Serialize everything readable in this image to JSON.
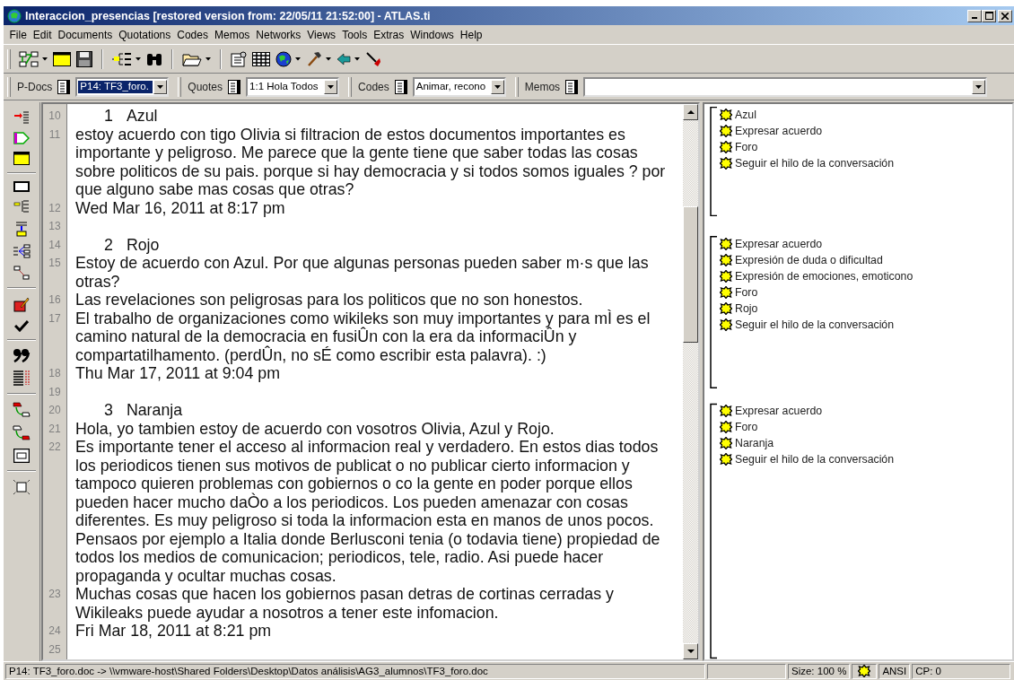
{
  "window": {
    "title": "Interaccion_presencias [restored version from: 22/05/11 21:52:00] - ATLAS.ti"
  },
  "menu": [
    "File",
    "Edit",
    "Documents",
    "Quotations",
    "Codes",
    "Memos",
    "Networks",
    "Views",
    "Tools",
    "Extras",
    "Windows",
    "Help"
  ],
  "selectors": [
    {
      "label": "P-Docs",
      "value": "P14: TF3_foro.",
      "selected": true
    },
    {
      "label": "Quotes",
      "value": "1:1 Hola Todos",
      "selected": false
    },
    {
      "label": "Codes",
      "value": "Animar, recono",
      "selected": false
    },
    {
      "label": "Memos",
      "selected": false
    }
  ],
  "document": {
    "lines": [
      {
        "number": "10",
        "kind": "heading",
        "index": "1",
        "name": "Azul"
      },
      {
        "number": "11",
        "kind": "text",
        "text": "estoy acuerdo con tigo Olivia si filtracion de estos documentos importantes es importante y peligroso. Me parece que la gente tiene que saber todas las cosas sobre politicos de su pais. porque si hay democracia y si todos somos iguales ? por que alguno sabe mas cosas que otras?"
      },
      {
        "number": "12",
        "kind": "text",
        "text": "Wed Mar 16, 2011 at 8:17 pm"
      },
      {
        "number": "13",
        "kind": "blank"
      },
      {
        "number": "14",
        "kind": "heading",
        "index": "2",
        "name": "Rojo"
      },
      {
        "number": "15",
        "kind": "text",
        "text": "Estoy de acuerdo con Azul. Por que algunas personas pueden saber m·s que las otras?"
      },
      {
        "number": "16",
        "kind": "text",
        "text": "Las revelaciones son peligrosas para los politicos que no son honestos."
      },
      {
        "number": "17",
        "kind": "text",
        "text": "El trabalho de organizaciones como wikileks son muy importantes y para mÌ es el camino natural de la democracia en fusiÛn con la era da informaciÛn y compartatilhamento. (perdÛn, no sÉ como escribir esta palavra). :)"
      },
      {
        "number": "18",
        "kind": "text",
        "text": "Thu Mar 17, 2011 at 9:04 pm"
      },
      {
        "number": "19",
        "kind": "blank"
      },
      {
        "number": "20",
        "kind": "heading",
        "index": "3",
        "name": "Naranja"
      },
      {
        "number": "21",
        "kind": "text",
        "text": "Hola, yo tambien estoy de acuerdo con vosotros Olivia, Azul y Rojo."
      },
      {
        "number": "22",
        "kind": "text",
        "text": "Es importante tener el acceso al informacion real y verdadero. En estos dias todos los periodicos tienen sus motivos de publicat o no publicar cierto informacion y tampoco quieren problemas con gobiernos o co la gente en poder porque ellos pueden hacer mucho daÒo a los periodicos. Los pueden amenazar con cosas diferentes. Es muy peligroso si toda la informacion esta en manos de unos pocos. Pensaos por ejemplo a Italia donde Berlusconi tenia (o todavia tiene) propiedad de todos los medios de comunicacion; periodicos, tele, radio. Asi puede hacer propaganda y ocultar muchas cosas."
      },
      {
        "number": "23",
        "kind": "text",
        "text": "Muchas cosas que hacen los gobiernos pasan detras de cortinas cerradas y Wikileaks puede ayudar a nosotros a tener este infomacion."
      },
      {
        "number": "24",
        "kind": "text",
        "text": "Fri Mar 18, 2011 at 8:21 pm"
      },
      {
        "number": "25",
        "kind": "blank"
      }
    ]
  },
  "code_margin": {
    "groups": [
      {
        "codes": [
          "Azul",
          "Expresar acuerdo",
          "Foro",
          "Seguir el hilo de la conversación"
        ]
      },
      {
        "codes": [
          "Expresar acuerdo",
          "Expresión de duda o dificultad",
          "Expresión de emociones, emoticono",
          "Foro",
          "Rojo",
          "Seguir el hilo de la conversación"
        ]
      },
      {
        "codes": [
          "Expresar acuerdo",
          "Foro",
          "Naranja",
          "Seguir el hilo de la conversación"
        ]
      }
    ]
  },
  "status_bar": {
    "path": "P14: TF3_foro.doc -> \\\\vmware-host\\Shared Folders\\Desktop\\Datos análisis\\AG3_alumnos\\TF3_foro.doc",
    "size": "Size: 100 %",
    "encoding": "ANSI",
    "position": "CP: 0"
  }
}
